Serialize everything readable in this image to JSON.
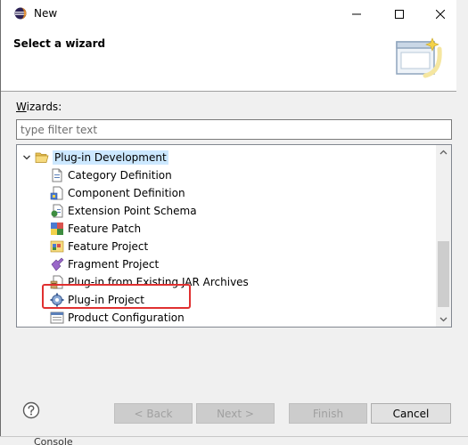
{
  "window": {
    "title": "New",
    "min_icon": "minimize-icon",
    "max_icon": "maximize-icon",
    "close_icon": "close-icon"
  },
  "header": {
    "title": "Select a wizard",
    "image_icon": "wizard-banner-icon"
  },
  "wizards": {
    "label_prefix": "W",
    "label_rest": "izards:",
    "filter_placeholder": "type filter text"
  },
  "tree": {
    "category": {
      "label": "Plug-in Development",
      "expanded": true,
      "icon": "open-folder-icon"
    },
    "items": [
      {
        "label": "Category Definition",
        "icon": "category-definition-icon"
      },
      {
        "label": "Component Definition",
        "icon": "component-definition-icon"
      },
      {
        "label": "Extension Point Schema",
        "icon": "extension-point-schema-icon"
      },
      {
        "label": "Feature Patch",
        "icon": "feature-patch-icon"
      },
      {
        "label": "Feature Project",
        "icon": "feature-project-icon"
      },
      {
        "label": "Fragment Project",
        "icon": "fragment-project-icon"
      },
      {
        "label": "Plug-in from Existing JAR Archives",
        "icon": "plugin-jar-icon"
      },
      {
        "label": "Plug-in Project",
        "icon": "plugin-project-icon",
        "highlighted": true
      },
      {
        "label": "Product Configuration",
        "icon": "product-configuration-icon"
      }
    ]
  },
  "footer": {
    "help_icon": "help-icon",
    "back_label": "< Back",
    "next_label": "Next >",
    "finish_label": "Finish",
    "cancel_label": "Cancel"
  },
  "background": {
    "bottom_tab": "Console"
  },
  "colors": {
    "selection": "#cce8ff",
    "highlight_border": "#e03030",
    "dialog_bg": "#f0f0f0"
  }
}
